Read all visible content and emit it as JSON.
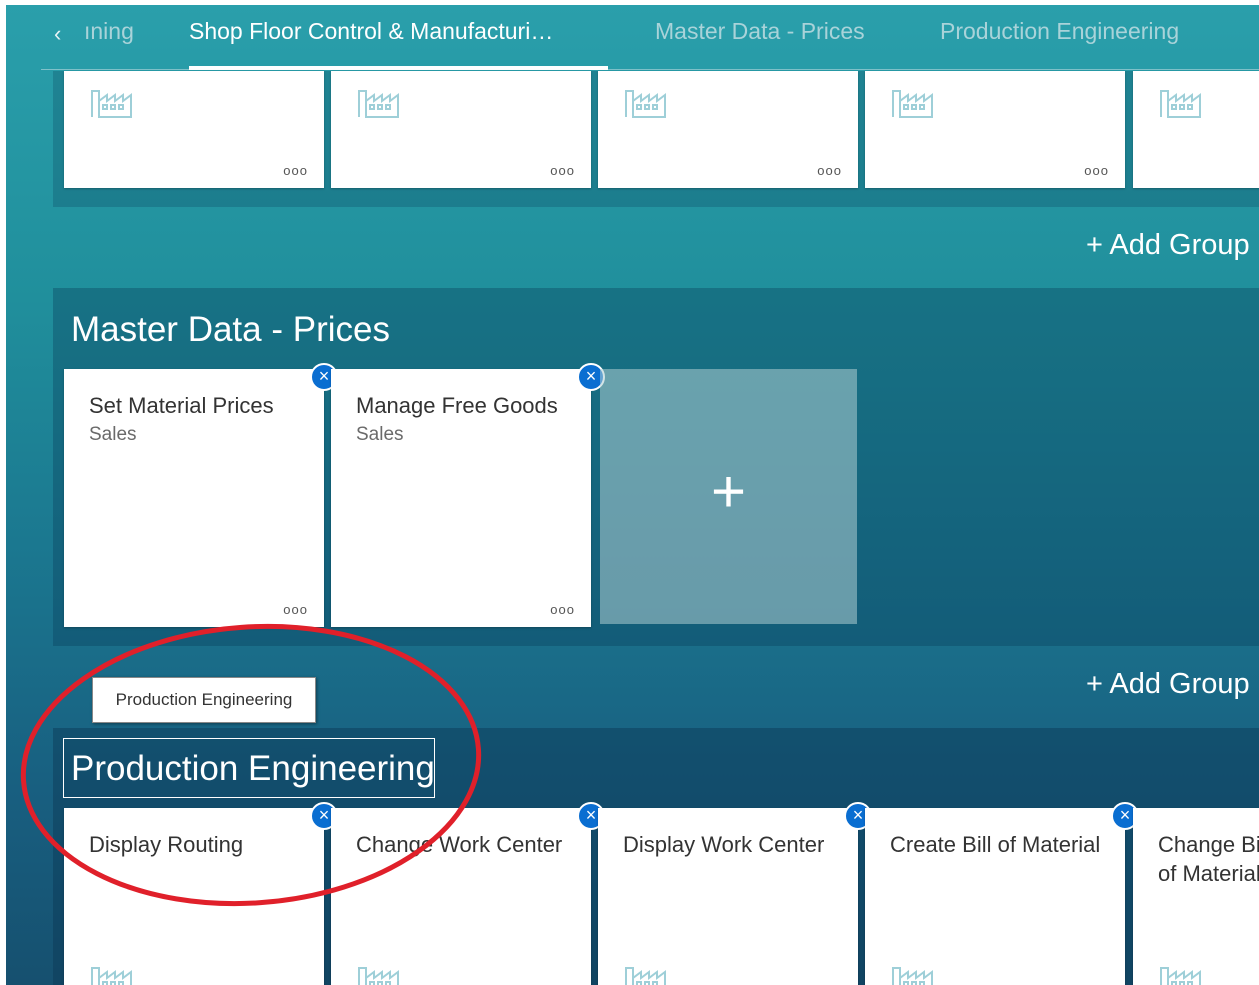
{
  "tabs": {
    "back_label": "‹",
    "items": [
      {
        "label": "ıning"
      },
      {
        "label": "Shop Floor Control & Manufacturi…"
      },
      {
        "label": "Master Data - Prices"
      },
      {
        "label": "Production Engineering"
      }
    ],
    "active_index": 1
  },
  "top_group": {
    "tiles": [
      {
        "more": "ooo"
      },
      {
        "more": "ooo"
      },
      {
        "more": "ooo"
      },
      {
        "more": "ooo"
      },
      {
        "more": ""
      }
    ]
  },
  "add_group_label": "+ Add Group",
  "master_data_prices": {
    "title": "Master Data - Prices",
    "tiles": [
      {
        "title": "Set Material Prices",
        "subtitle": "Sales",
        "more": "ooo"
      },
      {
        "title": "Manage Free Goods",
        "subtitle": "Sales",
        "more": "ooo"
      }
    ],
    "add_tile": "+"
  },
  "production_engineering": {
    "tooltip": "Production Engineering",
    "title": "Production Engineering",
    "tiles": [
      {
        "title": "Display Routing"
      },
      {
        "title": "Change Work Center"
      },
      {
        "title": "Display Work Center"
      },
      {
        "title": "Create Bill of Material"
      },
      {
        "title": "Change Bill of Material"
      }
    ]
  },
  "close_glyph": "×",
  "colors": {
    "accent": "#0a6ed1",
    "annotation": "#e0202a",
    "icon": "#9ecfd8"
  }
}
